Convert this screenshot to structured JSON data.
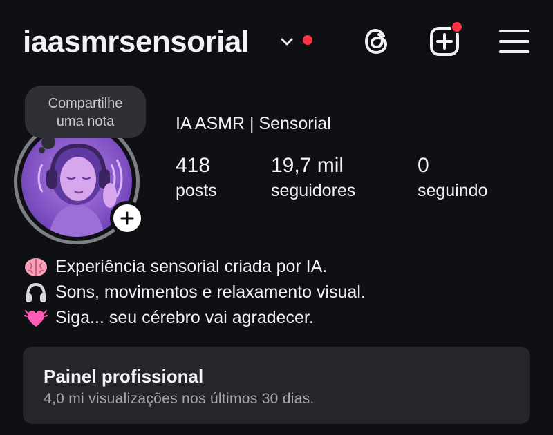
{
  "header": {
    "username": "iaasmrsensorial",
    "notification_color": "#ff3040",
    "icons": [
      "threads-icon",
      "add-post-icon",
      "menu-icon"
    ]
  },
  "note": {
    "text_line1": "Compartilhe",
    "text_line2": "uma nota"
  },
  "profile": {
    "display_name": "IA ASMR | Sensorial",
    "stats": [
      {
        "value": "418",
        "label": "posts"
      },
      {
        "value": "19,7 mil",
        "label": "seguidores"
      },
      {
        "value": "0",
        "label": "seguindo"
      }
    ]
  },
  "bio": [
    {
      "icon": "brain-emoji",
      "text": "Experiência sensorial criada por IA."
    },
    {
      "icon": "headphones-emoji",
      "text": "Sons, movimentos e relaxamento visual."
    },
    {
      "icon": "heart-emoji",
      "text": "Siga... seu cérebro vai agradecer."
    }
  ],
  "dashboard": {
    "title": "Painel profissional",
    "subtitle": "4,0 mi visualizações nos últimos 30 dias."
  }
}
